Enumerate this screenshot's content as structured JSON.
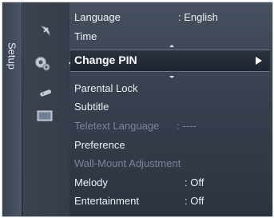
{
  "sidebar": {
    "tab_label": "Setup"
  },
  "icons": [
    "satellite-dish",
    "gear",
    "remote-control",
    "monitor-screen"
  ],
  "menu": {
    "above": [
      {
        "label": "Language",
        "value": ": English"
      },
      {
        "label": "Time",
        "value": ""
      }
    ],
    "selected": {
      "label": "Change PIN"
    },
    "below": [
      {
        "label": "Parental Lock",
        "value": "",
        "enabled": true
      },
      {
        "label": "Subtitle",
        "value": "",
        "enabled": true
      },
      {
        "label": "Teletext Language",
        "value": ": ----",
        "enabled": false
      },
      {
        "label": "Preference",
        "value": "",
        "enabled": true
      },
      {
        "label": "Wall-Mount Adjustment",
        "value": "",
        "enabled": false
      },
      {
        "label": "Melody",
        "value": ": Off",
        "enabled": true
      },
      {
        "label": "Entertainment",
        "value": ": Off",
        "enabled": true
      }
    ]
  },
  "colors": {
    "panel": "#394150",
    "highlight": "#1f2530",
    "text": "#eef1f5",
    "disabled": "#7c8594"
  }
}
